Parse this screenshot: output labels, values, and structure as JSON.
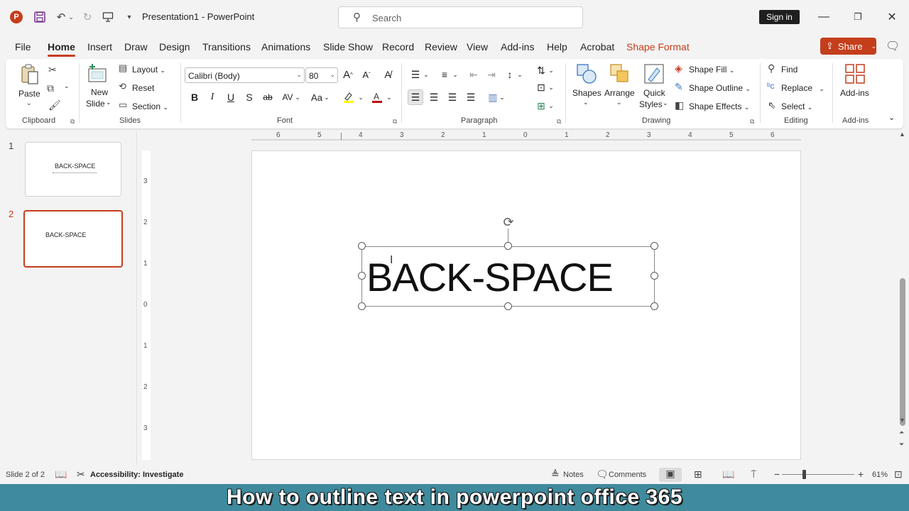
{
  "titlebar": {
    "doc_title": "Presentation1  -  PowerPoint",
    "search_placeholder": "Search",
    "signin_label": "Sign in"
  },
  "menu": {
    "tabs": [
      "File",
      "Home",
      "Insert",
      "Draw",
      "Design",
      "Transitions",
      "Animations",
      "Slide Show",
      "Record",
      "Review",
      "View",
      "Add-ins",
      "Help",
      "Acrobat",
      "Shape Format"
    ],
    "active_tab": "Home",
    "share_label": "Share"
  },
  "ribbon": {
    "clipboard": {
      "paste": "Paste",
      "group": "Clipboard"
    },
    "slides": {
      "new_slide_1": "New",
      "new_slide_2": "Slide",
      "layout": "Layout",
      "reset": "Reset",
      "section": "Section",
      "group": "Slides"
    },
    "font": {
      "font_name": "Calibri (Body)",
      "font_size": "80",
      "bold": "B",
      "italic": "I",
      "underline": "U",
      "shadow": "S",
      "strike": "ab",
      "group": "Font"
    },
    "paragraph": {
      "group": "Paragraph"
    },
    "drawing": {
      "shapes": "Shapes",
      "arrange": "Arrange",
      "quick_styles_1": "Quick",
      "quick_styles_2": "Styles",
      "shape_fill": "Shape Fill",
      "shape_outline": "Shape Outline",
      "shape_effects": "Shape Effects",
      "group": "Drawing"
    },
    "editing": {
      "find": "Find",
      "replace": "Replace",
      "select": "Select",
      "group": "Editing"
    },
    "addins": {
      "label": "Add-ins",
      "group": "Add-ins"
    }
  },
  "thumbnails": [
    {
      "number": "1",
      "text": "BACK-SPACE",
      "selected": false
    },
    {
      "number": "2",
      "text": "BACK-SPACE",
      "selected": true
    }
  ],
  "rulers": {
    "horizontal": [
      "6",
      "5",
      "4",
      "3",
      "2",
      "1",
      "0",
      "1",
      "2",
      "3",
      "4",
      "5",
      "6"
    ],
    "vertical": [
      "3",
      "2",
      "1",
      "0",
      "1",
      "2",
      "3"
    ]
  },
  "slide": {
    "text": "BACK-SPACE"
  },
  "statusbar": {
    "slide_info": "Slide 2 of 2",
    "accessibility": "Accessibility: Investigate",
    "notes": "Notes",
    "comments": "Comments",
    "zoom": "61%"
  },
  "caption": "How to outline text in powerpoint office 365",
  "colors": {
    "accent": "#c43e1c",
    "caption_bg": "#3f8a9d"
  }
}
